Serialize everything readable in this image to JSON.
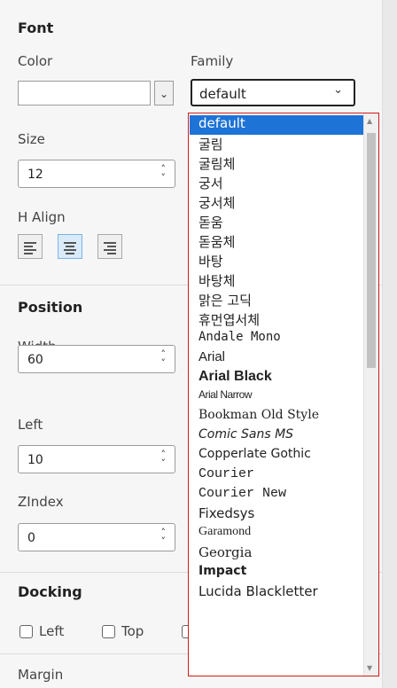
{
  "font": {
    "heading": "Font",
    "color_label": "Color",
    "family_label": "Family",
    "family_value": "default",
    "size_label": "Size",
    "size_value": "12",
    "halign_label": "H Align"
  },
  "position": {
    "heading": "Position",
    "width_label": "Width",
    "width_value": "60",
    "left_label": "Left",
    "left_value": "10",
    "zindex_label": "ZIndex",
    "zindex_value": "0"
  },
  "docking": {
    "heading": "Docking",
    "left_label": "Left",
    "top_label": "Top"
  },
  "margin_label": "Margin",
  "family_options": [
    "default",
    "굴림",
    "굴림체",
    "궁서",
    "궁서체",
    "돋움",
    "돋움체",
    "바탕",
    "바탕체",
    "맑은 고딕",
    "휴먼엽서체",
    "Andale Mono",
    "Arial",
    "Arial Black",
    "Arial Narrow",
    "Bookman Old Style",
    "Comic Sans MS",
    "Copperlate Gothic",
    "Courier",
    "Courier New",
    "Fixedsys",
    "Garamond",
    "Georgia",
    "Impact",
    "Lucida Blackletter"
  ],
  "selected_option": "default",
  "icons": {
    "dropdown": "chevron-down-icon",
    "spinner": "spinner-arrows-icon",
    "align_left": "align-left-icon",
    "align_center": "align-center-icon",
    "align_right": "align-right-icon"
  }
}
